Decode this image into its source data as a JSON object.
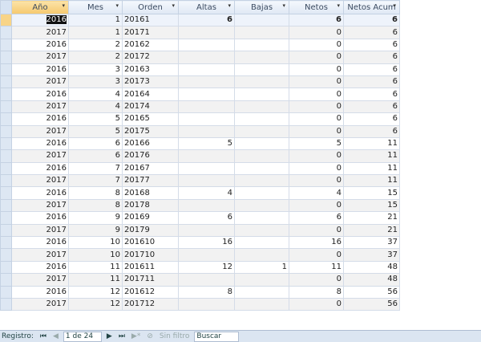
{
  "columns": [
    "Año",
    "Mes",
    "Orden",
    "Altas",
    "Bajas",
    "Netos",
    "Netos Acum"
  ],
  "rows": [
    [
      "2016",
      "1",
      "20161",
      "6",
      "",
      "6",
      "6"
    ],
    [
      "2017",
      "1",
      "20171",
      "",
      "",
      "0",
      "6"
    ],
    [
      "2016",
      "2",
      "20162",
      "",
      "",
      "0",
      "6"
    ],
    [
      "2017",
      "2",
      "20172",
      "",
      "",
      "0",
      "6"
    ],
    [
      "2016",
      "3",
      "20163",
      "",
      "",
      "0",
      "6"
    ],
    [
      "2017",
      "3",
      "20173",
      "",
      "",
      "0",
      "6"
    ],
    [
      "2016",
      "4",
      "20164",
      "",
      "",
      "0",
      "6"
    ],
    [
      "2017",
      "4",
      "20174",
      "",
      "",
      "0",
      "6"
    ],
    [
      "2016",
      "5",
      "20165",
      "",
      "",
      "0",
      "6"
    ],
    [
      "2017",
      "5",
      "20175",
      "",
      "",
      "0",
      "6"
    ],
    [
      "2016",
      "6",
      "20166",
      "5",
      "",
      "5",
      "11"
    ],
    [
      "2017",
      "6",
      "20176",
      "",
      "",
      "0",
      "11"
    ],
    [
      "2016",
      "7",
      "20167",
      "",
      "",
      "0",
      "11"
    ],
    [
      "2017",
      "7",
      "20177",
      "",
      "",
      "0",
      "11"
    ],
    [
      "2016",
      "8",
      "20168",
      "4",
      "",
      "4",
      "15"
    ],
    [
      "2017",
      "8",
      "20178",
      "",
      "",
      "0",
      "15"
    ],
    [
      "2016",
      "9",
      "20169",
      "6",
      "",
      "6",
      "21"
    ],
    [
      "2017",
      "9",
      "20179",
      "",
      "",
      "0",
      "21"
    ],
    [
      "2016",
      "10",
      "201610",
      "16",
      "",
      "16",
      "37"
    ],
    [
      "2017",
      "10",
      "201710",
      "",
      "",
      "0",
      "37"
    ],
    [
      "2016",
      "11",
      "201611",
      "12",
      "1",
      "11",
      "48"
    ],
    [
      "2017",
      "11",
      "201711",
      "",
      "",
      "0",
      "48"
    ],
    [
      "2016",
      "12",
      "201612",
      "8",
      "",
      "8",
      "56"
    ],
    [
      "2017",
      "12",
      "201712",
      "",
      "",
      "0",
      "56"
    ]
  ],
  "status": {
    "label": "Registro:",
    "first": "⏮",
    "prev": "◀",
    "position": "1 de 24",
    "next": "▶",
    "last": "⏭",
    "new": "▶*",
    "filter_icon": "⊘",
    "filter": "Sin filtro",
    "search": "Buscar"
  }
}
